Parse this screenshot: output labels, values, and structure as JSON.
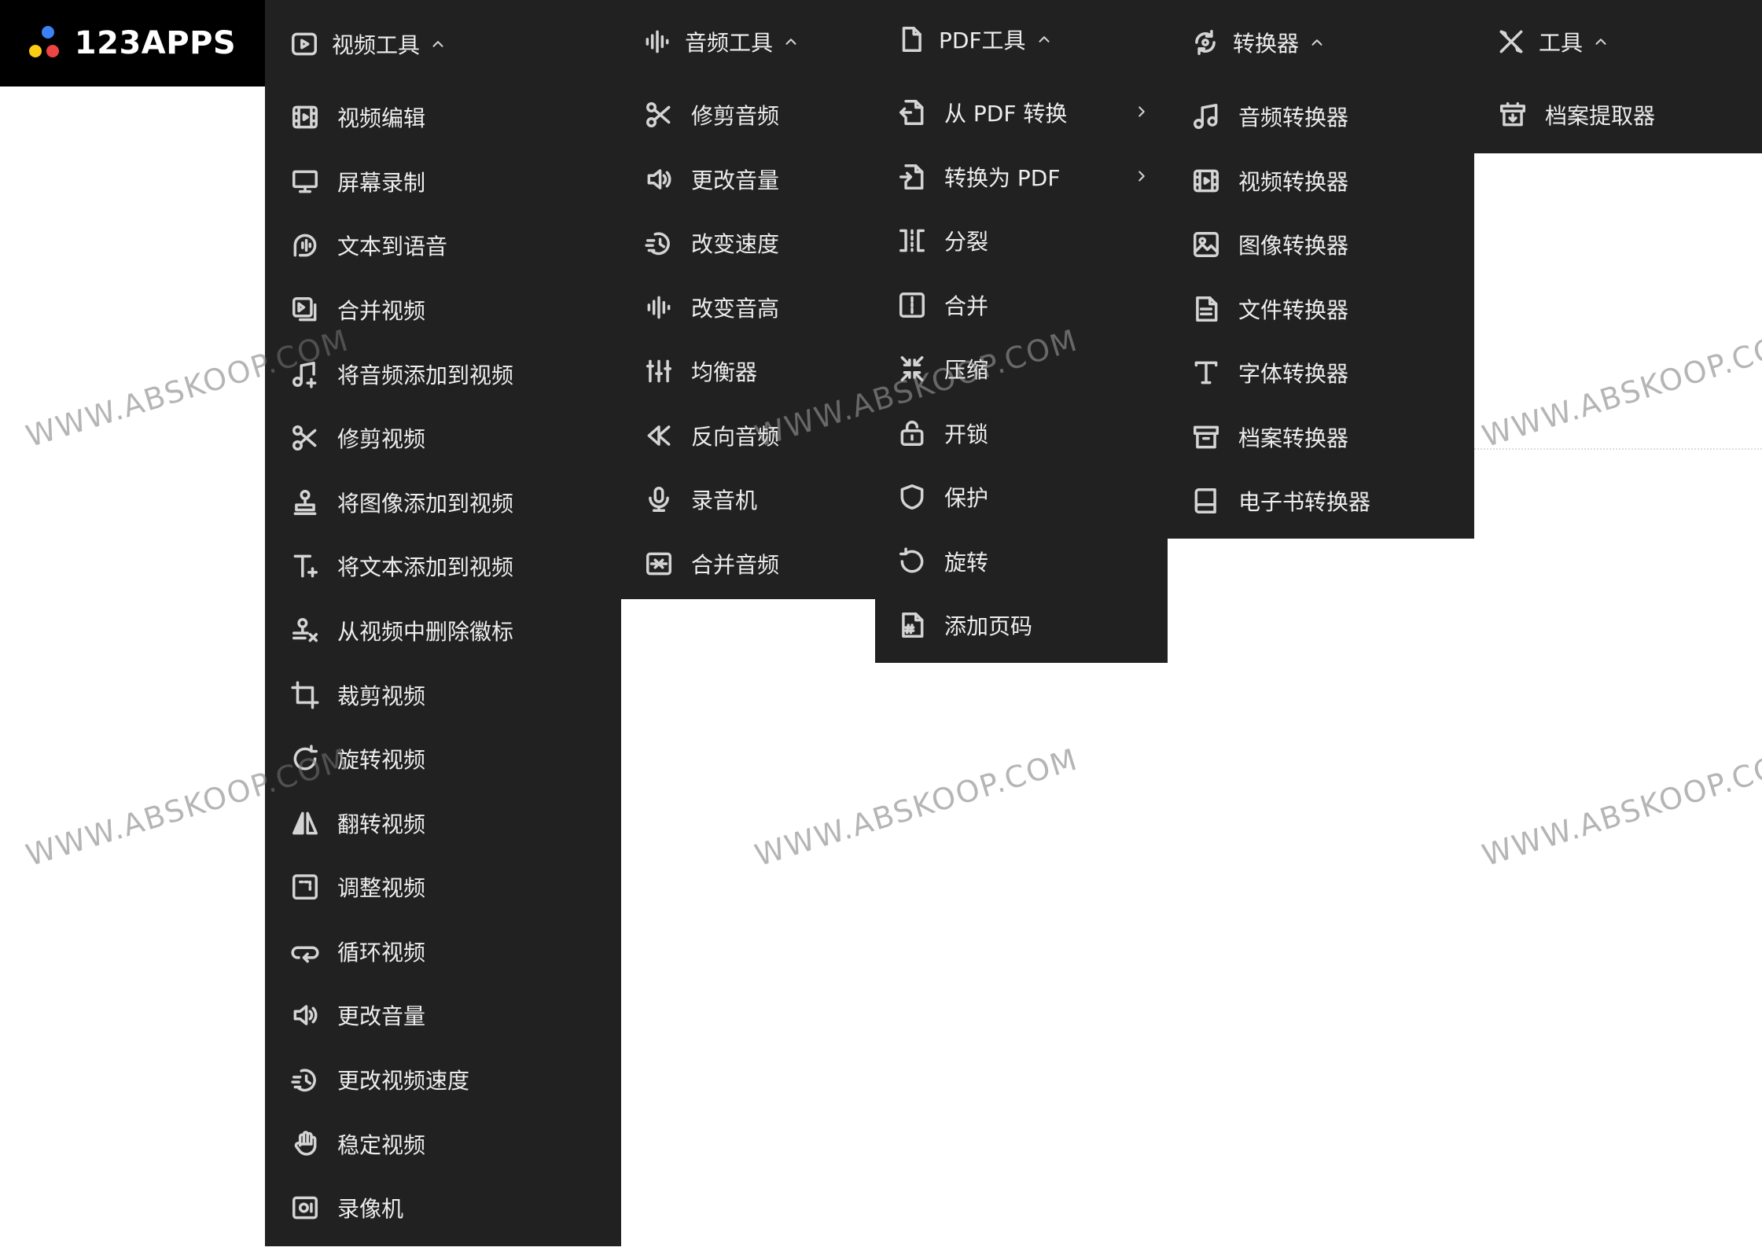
{
  "brand": {
    "name": "123APPS",
    "colors": {
      "blue": "#3b82f6",
      "red": "#ef4444",
      "yellow": "#facc15"
    }
  },
  "colors": {
    "panel": "#212121",
    "text": "#eeeeee",
    "icon": "#d4d4d4"
  },
  "menus": [
    {
      "title": "视频工具",
      "icon": "play-square-icon",
      "items": [
        {
          "label": "视频编辑",
          "icon": "film-icon"
        },
        {
          "label": "屏幕录制",
          "icon": "monitor-icon"
        },
        {
          "label": "文本到语音",
          "icon": "voice-icon"
        },
        {
          "label": "合并视频",
          "icon": "merge-video-icon"
        },
        {
          "label": "将音频添加到视频",
          "icon": "music-plus-icon"
        },
        {
          "label": "修剪视频",
          "icon": "scissors-icon"
        },
        {
          "label": "将图像添加到视频",
          "icon": "stamp-icon"
        },
        {
          "label": "将文本添加到视频",
          "icon": "text-plus-icon"
        },
        {
          "label": "从视频中删除徽标",
          "icon": "stamp-remove-icon"
        },
        {
          "label": "裁剪视频",
          "icon": "crop-icon"
        },
        {
          "label": "旋转视频",
          "icon": "rotate-icon"
        },
        {
          "label": "翻转视频",
          "icon": "flip-icon"
        },
        {
          "label": "调整视频",
          "icon": "resize-icon"
        },
        {
          "label": "循环视频",
          "icon": "loop-icon"
        },
        {
          "label": "更改音量",
          "icon": "volume-icon"
        },
        {
          "label": "更改视频速度",
          "icon": "speed-icon"
        },
        {
          "label": "稳定视频",
          "icon": "stabilize-icon"
        },
        {
          "label": "录像机",
          "icon": "camera-icon"
        }
      ]
    },
    {
      "title": "音频工具",
      "icon": "waveform-icon",
      "items": [
        {
          "label": "修剪音频",
          "icon": "scissors-icon"
        },
        {
          "label": "更改音量",
          "icon": "volume-icon"
        },
        {
          "label": "改变速度",
          "icon": "speed-icon"
        },
        {
          "label": "改变音高",
          "icon": "waveform-icon"
        },
        {
          "label": "均衡器",
          "icon": "equalizer-icon"
        },
        {
          "label": "反向音频",
          "icon": "rewind-icon"
        },
        {
          "label": "录音机",
          "icon": "microphone-icon"
        },
        {
          "label": "合并音频",
          "icon": "merge-audio-icon"
        }
      ]
    },
    {
      "title": "PDF工具",
      "icon": "document-icon",
      "items": [
        {
          "label": "从 PDF 转换",
          "icon": "file-convert-from-icon",
          "submenu": true
        },
        {
          "label": "转换为 PDF",
          "icon": "file-convert-to-icon",
          "submenu": true
        },
        {
          "label": "分裂",
          "icon": "split-icon"
        },
        {
          "label": "合并",
          "icon": "merge-icon"
        },
        {
          "label": "压缩",
          "icon": "compress-icon"
        },
        {
          "label": "开锁",
          "icon": "unlock-icon"
        },
        {
          "label": "保护",
          "icon": "shield-icon"
        },
        {
          "label": "旋转",
          "icon": "rotate-left-icon"
        },
        {
          "label": "添加页码",
          "icon": "page-number-icon"
        }
      ]
    },
    {
      "title": "转换器",
      "icon": "convert-icon",
      "items": [
        {
          "label": "音频转换器",
          "icon": "music-note-icon"
        },
        {
          "label": "视频转换器",
          "icon": "film-icon"
        },
        {
          "label": "图像转换器",
          "icon": "image-icon"
        },
        {
          "label": "文件转换器",
          "icon": "file-text-icon"
        },
        {
          "label": "字体转换器",
          "icon": "font-icon"
        },
        {
          "label": "档案转换器",
          "icon": "archive-icon"
        },
        {
          "label": "电子书转换器",
          "icon": "book-icon"
        }
      ]
    },
    {
      "title": "工具",
      "icon": "tools-icon",
      "items": [
        {
          "label": "档案提取器",
          "icon": "archive-extract-icon"
        }
      ]
    }
  ],
  "watermark": "WWW.ABSKOOP.COM"
}
